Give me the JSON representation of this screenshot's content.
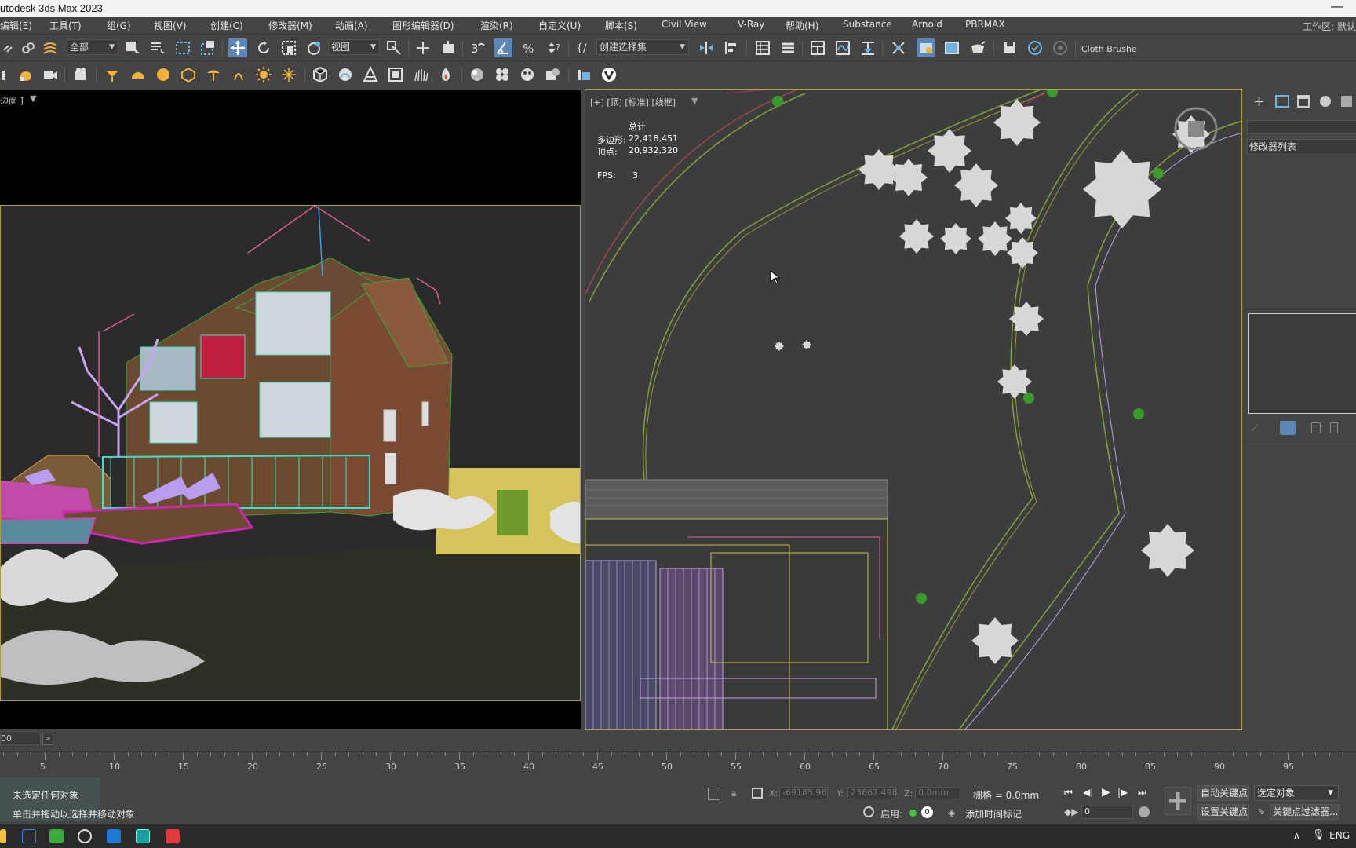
{
  "window": {
    "title": "utodesk 3ds Max 2023",
    "minimize": "—"
  },
  "menu": {
    "items": [
      "编辑(E)",
      "工具(T)",
      "组(G)",
      "视图(V)",
      "创建(C)",
      "修改器(M)",
      "动画(A)",
      "图形编辑器(D)",
      "渲染(R)",
      "自定义(U)",
      "脚本(S)",
      "Civil View",
      "V-Ray",
      "帮助(H)",
      "Substance",
      "Arnold",
      "PBRMAX"
    ],
    "workspace": "工作区: 默认"
  },
  "toolbar": {
    "filter_dropdown": "全部",
    "refcoord_dropdown": "视图",
    "named_selection": "创建选择集",
    "cloth_label": "Cloth Brushe"
  },
  "viewport_left": {
    "label": "边面 ]"
  },
  "viewport_right": {
    "label": "[+] [顶] [标准] [线框]",
    "stats": {
      "header": "总计",
      "poly_label": "多边形:",
      "poly_value": "22,418,451",
      "vert_label": "顶点:",
      "vert_value": "20,932,320",
      "fps_label": "FPS:",
      "fps_value": "3"
    }
  },
  "command_panel": {
    "modifier_list": "修改器列表"
  },
  "timeline": {
    "frame_display": "00",
    "next_arrow": ">",
    "ticks": [
      "5",
      "10",
      "15",
      "20",
      "25",
      "30",
      "35",
      "40",
      "45",
      "50",
      "55",
      "60",
      "65",
      "70",
      "75",
      "80",
      "85",
      "90",
      "95"
    ]
  },
  "status": {
    "line1": "未选定任何对象",
    "line2": "单击并拖动以选择并移动对象",
    "x_label": "X:",
    "x_value": "-69185.96",
    "y_label": "Y:",
    "y_value": "23667.498",
    "z_label": "Z:",
    "z_value": "0.0mm",
    "grid": "栅格 = 0.0mm",
    "enable": "启用:",
    "enable_value": "0",
    "add_time_tag": "添加时间标记",
    "frame_value": "0",
    "auto_key": "自动关键点",
    "select_object": "选定对象",
    "set_key": "设置关键点",
    "key_filters": "关键点过滤器..."
  },
  "taskbar": {
    "lang": "ENG"
  },
  "colors": {
    "accent": "#5b86b5",
    "viewport_border": "#b8a23e",
    "tree": "#d7d7d7"
  }
}
